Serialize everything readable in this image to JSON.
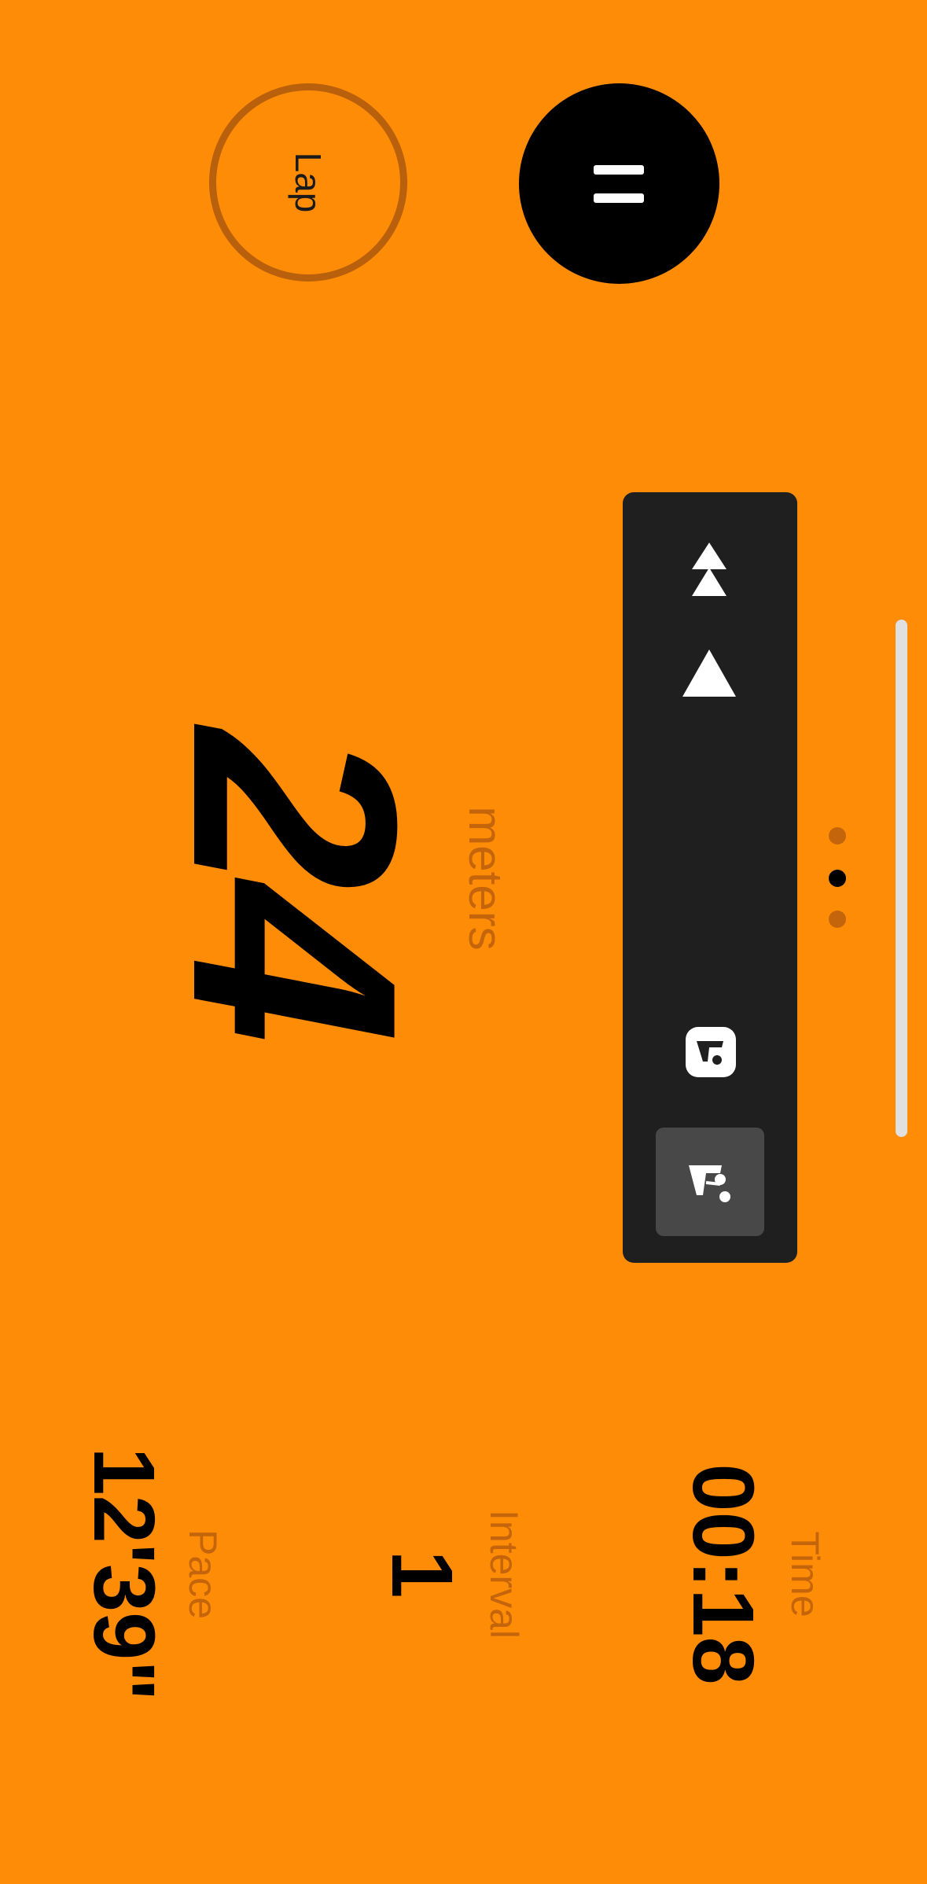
{
  "controls": {
    "lap_label": "Lap",
    "pause_icon": "pause-icon"
  },
  "workout": {
    "distance_value": "24",
    "distance_unit": "meters"
  },
  "stats": {
    "pace": {
      "value": "12'39\"",
      "label": "Pace"
    },
    "interval": {
      "value": "1",
      "label": "Interval"
    },
    "time": {
      "value": "00:18",
      "label": "Time"
    }
  },
  "panel": {
    "icons": [
      "double-up-arrow-icon",
      "up-arrow-icon",
      "route-card-icon",
      "route-icon"
    ],
    "selected": "route-icon"
  },
  "pagination": {
    "count": 3,
    "active_index": 1
  },
  "colors": {
    "background": "#FF8C06",
    "accent_dim": "#C5650B",
    "lap_ring": "#B8600C",
    "panel": "#1F1F1F",
    "panel_selected": "#484848"
  }
}
